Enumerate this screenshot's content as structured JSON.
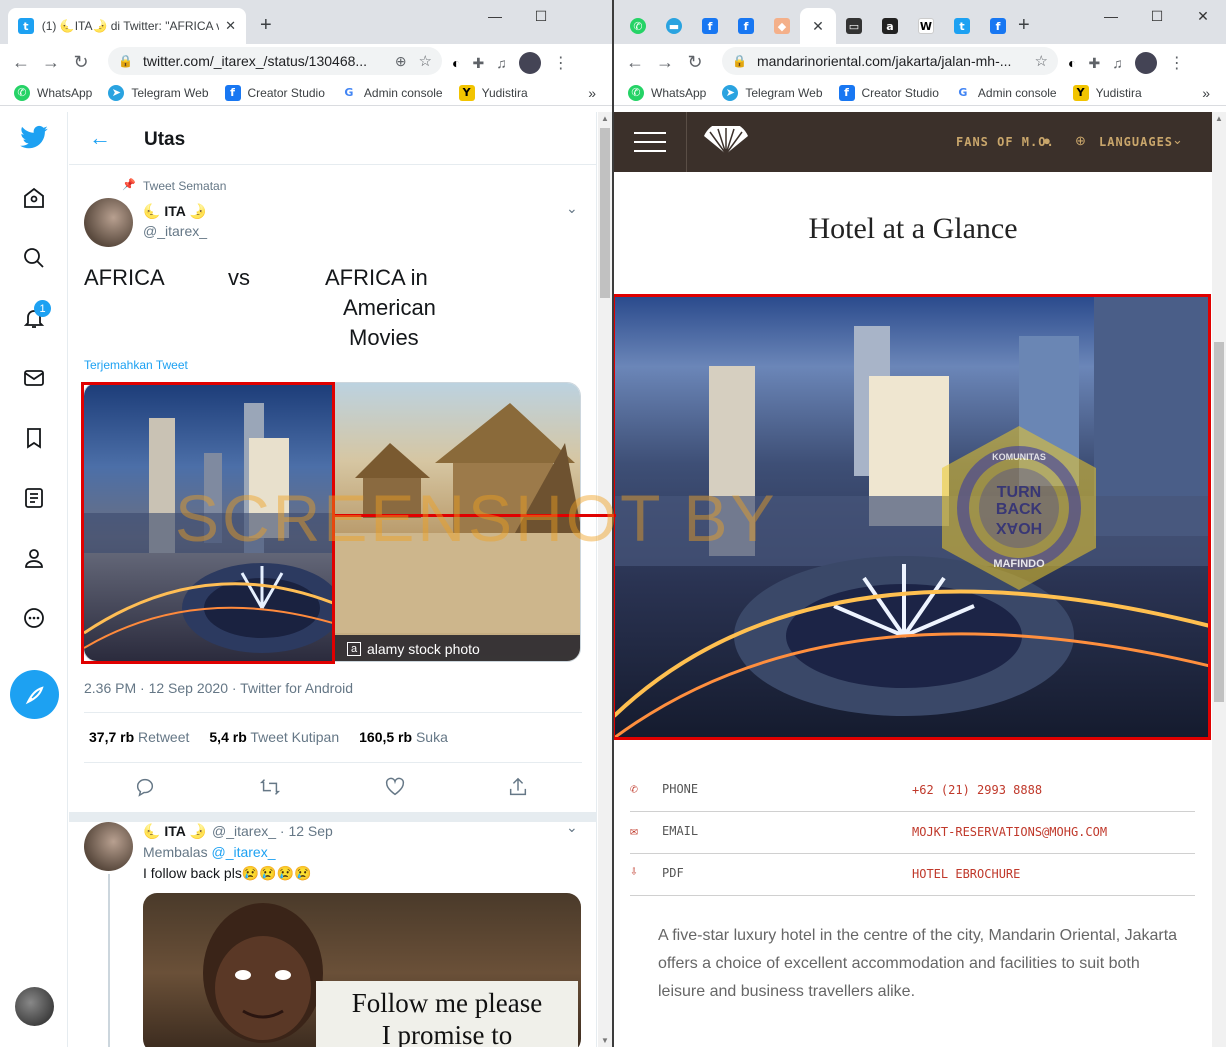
{
  "left_browser": {
    "tab_title": "(1) 🌜ITA🌛 di Twitter: \"AFRICA v",
    "new_tab_symbol": "+",
    "url": "twitter.com/_itarex_/status/130468...",
    "bookmarks": [
      "WhatsApp",
      "Telegram Web",
      "Creator Studio",
      "Admin console",
      "Yudistira"
    ],
    "overflow_chevron": "»"
  },
  "twitter": {
    "notification_count": "1",
    "header_title": "Utas",
    "pinned_label": "Tweet Sematan",
    "author_name": "🌜 ITA 🌛",
    "author_handle": "@_itarex_",
    "tweet_text_left": "AFRICA",
    "tweet_text_vs": "vs",
    "tweet_text_right_l1": "AFRICA in",
    "tweet_text_right_l2": "American",
    "tweet_text_right_l3": "Movies",
    "translate_link": "Terjemahkan Tweet",
    "alamy_badge": "a",
    "alamy_caption": "alamy stock photo",
    "timestamp": "2.36 PM · 12 Sep 2020 · Twitter for Android",
    "stats": [
      {
        "count": "37,7 rb",
        "label": "Retweet"
      },
      {
        "count": "5,4 rb",
        "label": "Tweet Kutipan"
      },
      {
        "count": "160,5 rb",
        "label": "Suka"
      }
    ],
    "reply": {
      "author_name": "🌜 ITA 🌛",
      "handle_date": "@_itarex_ · 12 Sep",
      "replying_prefix": "Membalas",
      "replying_handle": "@_itarex_",
      "text": "I follow back pls😢😢😢😢",
      "meme_line1": "Follow me please",
      "meme_line2": "I promise to"
    }
  },
  "watermark": {
    "text": "SCREENSHOT BY",
    "stamp_top": "KOMUNITAS",
    "stamp_mid1": "TURN",
    "stamp_mid2": "BACK",
    "stamp_mid3": "HOAX",
    "stamp_bottom": "MAFINDO"
  },
  "right_browser": {
    "url": "mandarinoriental.com/jakarta/jalan-mh-...",
    "new_tab_symbol": "+",
    "bookmarks": [
      "WhatsApp",
      "Telegram Web",
      "Creator Studio",
      "Admin console",
      "Yudistira"
    ],
    "overflow_chevron": "»"
  },
  "mandarin": {
    "fans_link": "FANS OF M.O.",
    "languages_link": "LANGUAGES",
    "heading": "Hotel at a Glance",
    "info": [
      {
        "label": "PHONE",
        "value": "+62 (21) 2993 8888"
      },
      {
        "label": "EMAIL",
        "value": "MOJKT-RESERVATIONS@MOHG.COM"
      },
      {
        "label": "PDF",
        "value": "HOTEL EBROCHURE"
      }
    ],
    "description": "A five-star luxury hotel in the centre of the city, Mandarin Oriental, Jakarta offers a choice of excellent accommodation and facilities to suit both leisure and business travellers alike."
  },
  "colors": {
    "twitter_blue": "#1da1f2",
    "highlight_red": "#e00000",
    "mo_brown": "#3b302a",
    "mo_gold": "#c9a66b",
    "mo_red": "#c0392b",
    "watermark_orange": "#f0a020"
  }
}
